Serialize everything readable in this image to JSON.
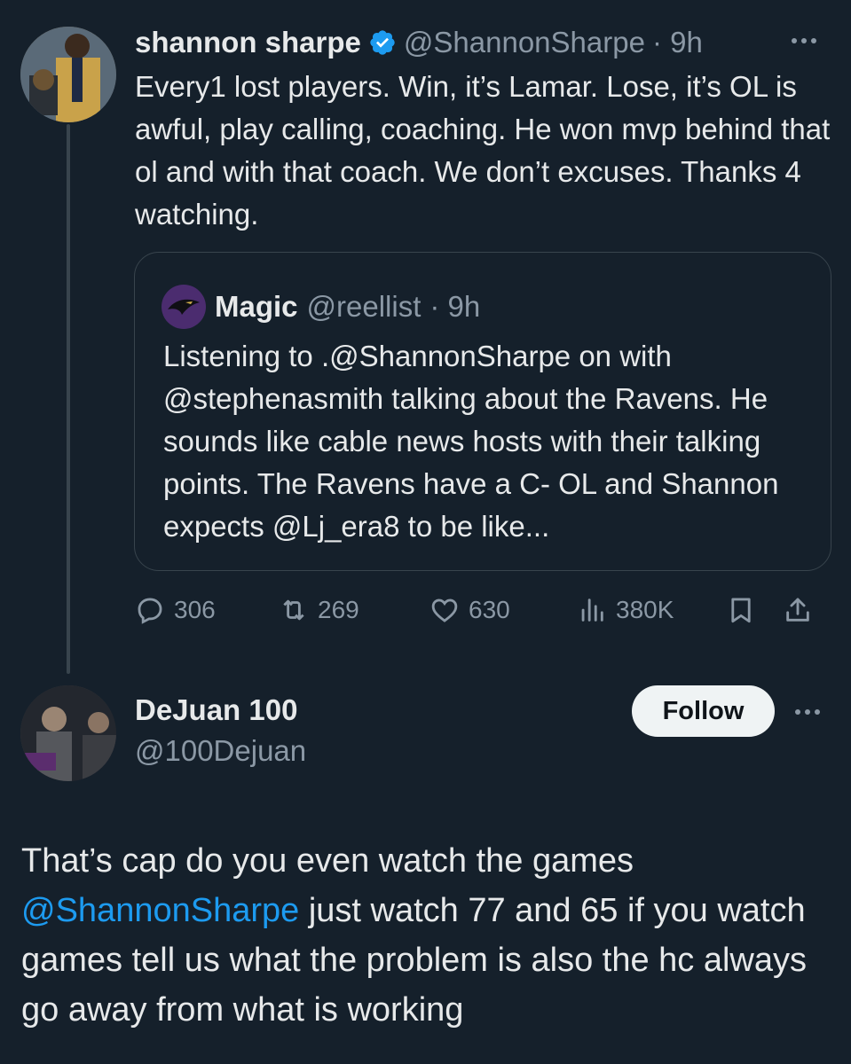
{
  "tweet": {
    "author_name": "shannon sharpe",
    "author_handle": "@ShannonSharpe",
    "time": "· 9h",
    "text": "Every1 lost players. Win, it’s Lamar. Lose, it’s OL is awful, play calling, coaching. He won mvp behind that ol and with that coach. We don’t excuses. Thanks 4 watching.",
    "quote": {
      "author_name": "Magic",
      "author_handle": "@reellist",
      "time": "· 9h",
      "text": "Listening to .@ShannonSharpe on with @stephenasmith talking about the Ravens. He sounds like cable news hosts with their talking points.  The Ravens have a C- OL and Shannon expects @Lj_era8 to be like..."
    },
    "stats": {
      "replies": "306",
      "retweets": "269",
      "likes": "630",
      "views": "380K"
    }
  },
  "reply": {
    "author_name": "DeJuan 100",
    "author_handle": "@100Dejuan",
    "follow_label": "Follow",
    "mention": "@ShannonSharpe",
    "text_before": "That’s cap do you even watch the games ",
    "text_after": " just watch 77 and 65 if you watch games tell us what the problem is also the hc always go away from what is working"
  },
  "colors": {
    "background": "#15202b",
    "accent": "#1d9bf0",
    "muted": "#8b98a5"
  }
}
